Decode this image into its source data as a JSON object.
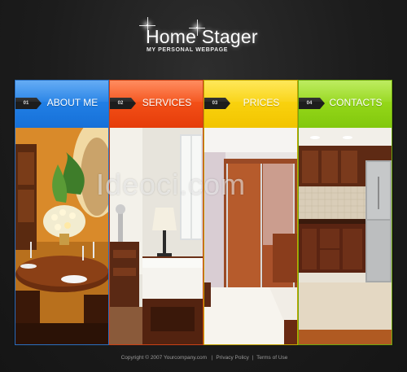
{
  "header": {
    "title": "Home Stager",
    "subtitle": "MY PERSONAL WEBPAGE"
  },
  "nav": [
    {
      "num": "01",
      "label": "ABOUT ME",
      "color": "#1a7ae0"
    },
    {
      "num": "02",
      "label": "SERVICES",
      "color": "#f24b12"
    },
    {
      "num": "03",
      "label": "PRICES",
      "color": "#f3cc00"
    },
    {
      "num": "04",
      "label": "CONTACTS",
      "color": "#8ed313"
    }
  ],
  "watermark": "Ideoci.com",
  "footer": {
    "copyright": "Copyright © 2007 Yourcompany.com",
    "separator": "|",
    "privacy": "Privacy Policy",
    "terms": "Terms of Use"
  }
}
